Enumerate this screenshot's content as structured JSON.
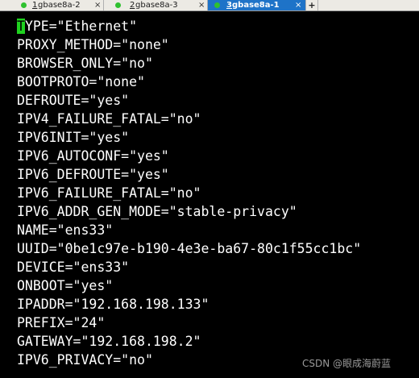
{
  "tabs": [
    {
      "number": "1",
      "name": " gbase8a-2",
      "dot_color": "#2fc12f",
      "active": false
    },
    {
      "number": "2",
      "name": " gbase8a-3",
      "dot_color": "#2fc12f",
      "active": false
    },
    {
      "number": "3",
      "name": " gbase8a-1",
      "dot_color": "#2fc12f",
      "active": true
    }
  ],
  "tab_close_glyph": "×",
  "tab_add_glyph": "+",
  "terminal": {
    "cursor_char": "T",
    "first_line_rest": "YPE=\"Ethernet\"",
    "lines": [
      "PROXY_METHOD=\"none\"",
      "BROWSER_ONLY=\"no\"",
      "BOOTPROTO=\"none\"",
      "DEFROUTE=\"yes\"",
      "IPV4_FAILURE_FATAL=\"no\"",
      "IPV6INIT=\"yes\"",
      "IPV6_AUTOCONF=\"yes\"",
      "IPV6_DEFROUTE=\"yes\"",
      "IPV6_FAILURE_FATAL=\"no\"",
      "IPV6_ADDR_GEN_MODE=\"stable-privacy\"",
      "NAME=\"ens33\"",
      "UUID=\"0be1c97e-b190-4e3e-ba67-80c1f55cc1bc\"",
      "DEVICE=\"ens33\"",
      "ONBOOT=\"yes\"",
      "IPADDR=\"192.168.198.133\"",
      "PREFIX=\"24\"",
      "GATEWAY=\"192.168.198.2\"",
      "IPV6_PRIVACY=\"no\""
    ],
    "cursor_color": "#1fd21f",
    "text_color": "#ffffff",
    "background_color": "#000000"
  },
  "watermark": "CSDN @眼成海蔚蓝"
}
